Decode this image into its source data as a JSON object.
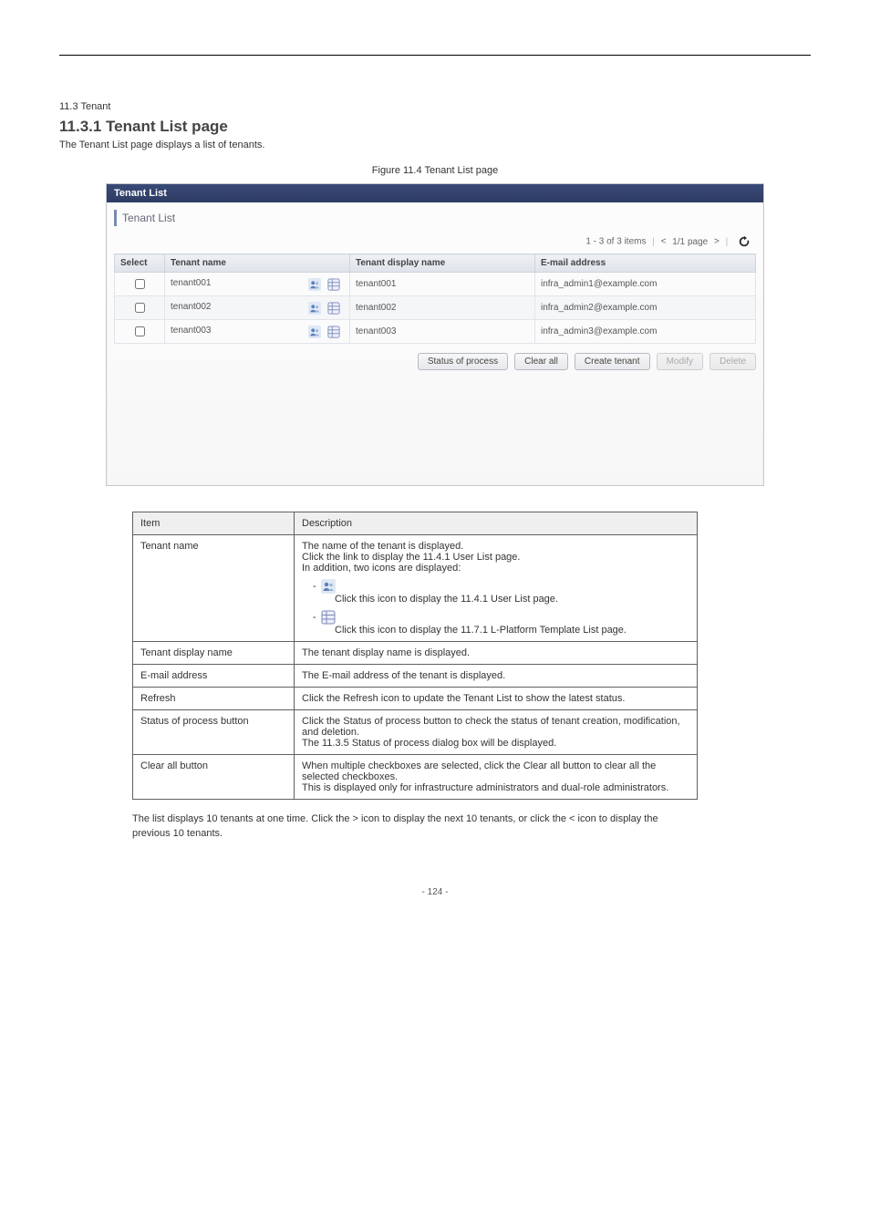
{
  "doc": {
    "heading_line": "11.3 Tenant",
    "main_head": "11.3.1 Tenant List page",
    "description": "The Tenant List page displays a list of tenants.",
    "figure_caption": "Figure 11.4 Tenant List page"
  },
  "panel": {
    "titlebar": "Tenant List",
    "subhead": "Tenant List",
    "pager_items": "1 - 3 of 3 items",
    "pager_page": "1/1 page",
    "pager_prev": "<",
    "pager_next": ">",
    "columns": {
      "select": "Select",
      "name": "Tenant name",
      "display": "Tenant display name",
      "email": "E-mail address"
    },
    "rows": [
      {
        "name": "tenant001",
        "display": "tenant001",
        "email": "infra_admin1@example.com"
      },
      {
        "name": "tenant002",
        "display": "tenant002",
        "email": "infra_admin2@example.com"
      },
      {
        "name": "tenant003",
        "display": "tenant003",
        "email": "infra_admin3@example.com"
      }
    ],
    "buttons": {
      "status": "Status of process",
      "clear": "Clear all",
      "create": "Create tenant",
      "modify": "Modify",
      "delete": "Delete"
    }
  },
  "ref": {
    "headers": {
      "item": "Item",
      "description": "Description"
    },
    "rows": [
      {
        "item": "Tenant name",
        "desc_lines": [
          "The name of the tenant is displayed.",
          "Click the link to display the 11.4.1 User List page.",
          "In addition, two icons are displayed:"
        ],
        "icon1_line": "Click this icon to display the 11.4.1 User List page.",
        "icon2_line": "Click this icon to display the 11.7.1 L-Platform Template List page."
      },
      {
        "item": "Tenant display name",
        "desc_lines": [
          "The tenant display name is displayed."
        ]
      },
      {
        "item": "E-mail address",
        "desc_lines": [
          "The E-mail address of the tenant is displayed."
        ]
      },
      {
        "item": "Refresh",
        "desc_lines": [
          "Click the Refresh icon to update the Tenant List to show the latest status."
        ]
      },
      {
        "item": "Status of process button",
        "desc_lines": [
          "Click the Status of process button to check the status of tenant creation, modification, and deletion.",
          "The 11.3.5 Status of process dialog box will be displayed."
        ]
      },
      {
        "item": "Clear all button",
        "desc_lines": [
          "When multiple checkboxes are selected, click the Clear all button to clear all the selected checkboxes.",
          "This is displayed only for infrastructure administrators and dual-role administrators."
        ]
      }
    ]
  },
  "after_text": "The list displays 10 tenants at one time. Click the > icon to display the next 10 tenants, or click the < icon to display the previous 10 tenants.",
  "footer": "- 124 -"
}
